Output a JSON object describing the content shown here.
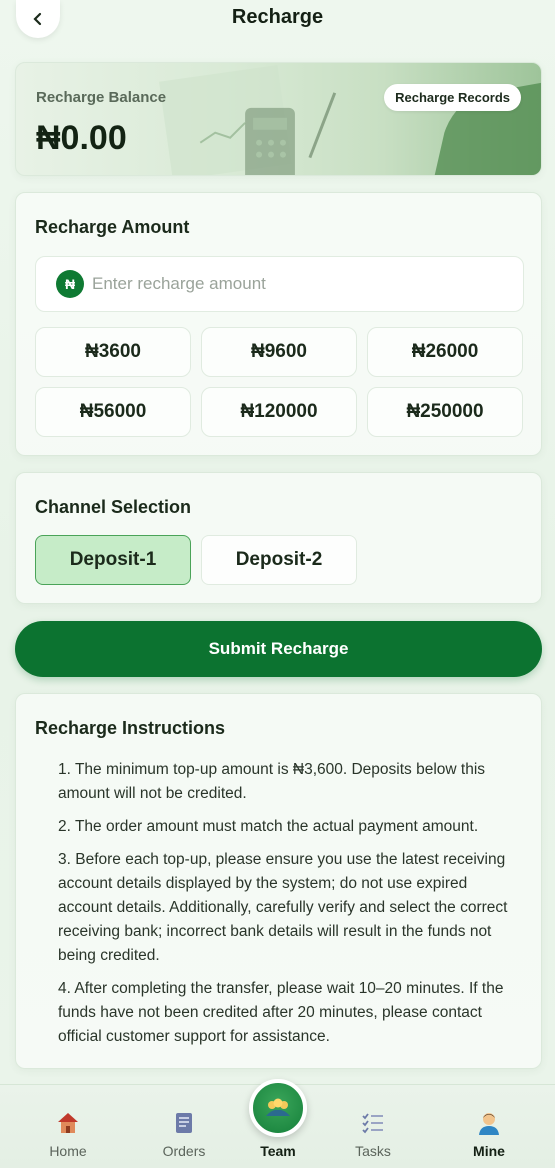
{
  "header": {
    "title": "Recharge",
    "back_icon": "chevron-left-icon"
  },
  "balance": {
    "label": "Recharge Balance",
    "value": "₦0.00",
    "records_button": "Recharge Records"
  },
  "amount_section": {
    "title": "Recharge Amount",
    "currency_icon": "naira-icon",
    "currency_symbol": "₦",
    "input_placeholder": "Enter recharge amount",
    "input_value": "",
    "presets": [
      "₦3600",
      "₦9600",
      "₦26000",
      "₦56000",
      "₦120000",
      "₦250000"
    ]
  },
  "channel_section": {
    "title": "Channel Selection",
    "channels": [
      {
        "label": "Deposit-1",
        "selected": true
      },
      {
        "label": "Deposit-2",
        "selected": false
      }
    ]
  },
  "submit_button": "Submit Recharge",
  "instructions": {
    "title": "Recharge Instructions",
    "items": [
      "1. The minimum top-up amount is ₦3,600. Deposits below this amount will not be credited.",
      "2. The order amount must match the actual payment amount.",
      "3. Before each top-up, please ensure you use the latest receiving account details displayed by the system; do not use expired account details. Additionally, carefully verify and select the correct receiving bank; incorrect bank details will result in the funds not being credited.",
      "4. After completing the transfer, please wait 10–20 minutes. If the funds have not been credited after 20 minutes, please contact official customer support for assistance."
    ]
  },
  "bottom_nav": {
    "items": [
      {
        "label": "Home",
        "icon": "home-icon",
        "active": false
      },
      {
        "label": "Orders",
        "icon": "orders-icon",
        "active": false
      },
      {
        "label": "Team",
        "icon": "team-icon",
        "active": true
      },
      {
        "label": "Tasks",
        "icon": "tasks-icon",
        "active": false
      },
      {
        "label": "Mine",
        "icon": "user-icon",
        "active": true
      }
    ]
  },
  "colors": {
    "primary": "#0c7330",
    "active_channel": "#c6ecc8",
    "background": "#eef7ee"
  }
}
